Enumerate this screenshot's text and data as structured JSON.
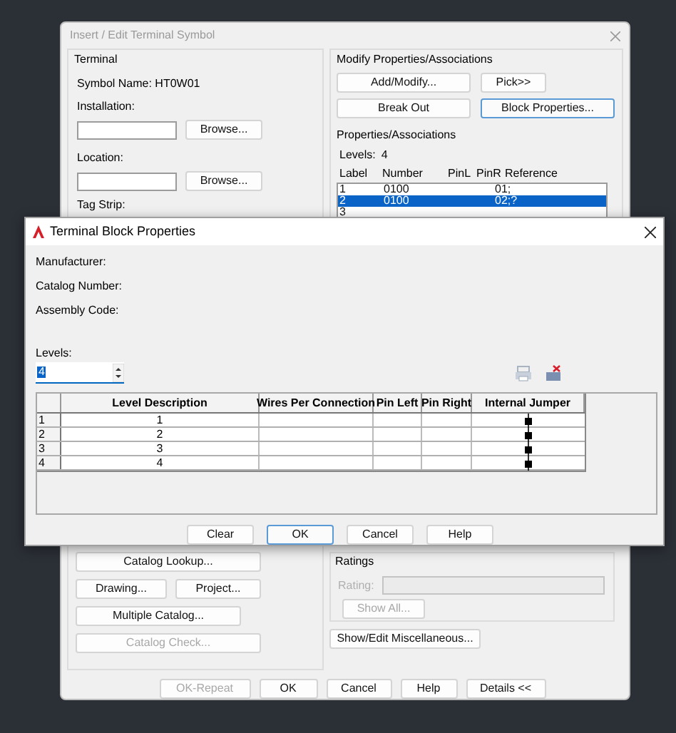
{
  "back_dialog": {
    "title": "Insert / Edit Terminal Symbol",
    "terminal": {
      "heading": "Terminal",
      "symbol_name": "Symbol Name: HT0W01",
      "installation_label": "Installation:",
      "installation_browse": "Browse...",
      "location_label": "Location:",
      "location_browse": "Browse...",
      "tag_strip_label": "Tag Strip:"
    },
    "modify": {
      "heading": "Modify Properties/Associations",
      "buttons": [
        {
          "label": "Add/Modify...",
          "focused": false
        },
        {
          "label": "Pick>>",
          "focused": false
        },
        {
          "label": "Break Out",
          "focused": false
        },
        {
          "label": "Block Properties...",
          "focused": true
        }
      ]
    },
    "associations": {
      "heading": "Properties/Associations",
      "levels_label": "Levels:",
      "levels_value": "4",
      "columns": [
        "Label",
        "Number",
        "PinL",
        "PinR",
        "Reference"
      ],
      "rows": [
        {
          "label": "1",
          "number": "0100",
          "reference": "01;",
          "selected": false
        },
        {
          "label": "2",
          "number": "0100",
          "reference": "02;?",
          "selected": true
        },
        {
          "label": "3",
          "number": "",
          "reference": "",
          "selected": false
        }
      ]
    },
    "catalog_buttons": [
      {
        "label": "Catalog Lookup...",
        "disabled": false
      },
      {
        "label": "Drawing...",
        "disabled": false
      },
      {
        "label": "Project...",
        "disabled": false
      },
      {
        "label": "Multiple Catalog...",
        "disabled": false
      },
      {
        "label": "Catalog Check...",
        "disabled": true
      }
    ],
    "ratings": {
      "heading": "Ratings",
      "rating_label": "Rating:",
      "show_all": "Show All...",
      "disabled": true
    },
    "misc_button": "Show/Edit Miscellaneous...",
    "footer_buttons": [
      {
        "label": "OK-Repeat",
        "disabled": true
      },
      {
        "label": "OK",
        "disabled": false
      },
      {
        "label": "Cancel",
        "disabled": false
      },
      {
        "label": "Help",
        "disabled": false
      },
      {
        "label": "Details <<",
        "disabled": false
      }
    ]
  },
  "block_dialog": {
    "title": "Terminal Block Properties",
    "fields": [
      "Manufacturer:",
      "Catalog Number:",
      "Assembly Code:"
    ],
    "levels_label": "Levels:",
    "levels_value": "4",
    "table": {
      "columns": [
        "Level Description",
        "Wires Per Connection",
        "Pin Left",
        "Pin Right",
        "Internal Jumper"
      ],
      "rows": [
        {
          "row": "1",
          "description": "1",
          "jumper": true
        },
        {
          "row": "2",
          "description": "2",
          "jumper": true
        },
        {
          "row": "3",
          "description": "3",
          "jumper": true
        },
        {
          "row": "4",
          "description": "4",
          "jumper": true
        }
      ]
    },
    "buttons": [
      {
        "label": "Clear",
        "focused": false
      },
      {
        "label": "OK",
        "focused": true
      },
      {
        "label": "Cancel",
        "focused": false
      },
      {
        "label": "Help",
        "focused": false
      }
    ]
  }
}
